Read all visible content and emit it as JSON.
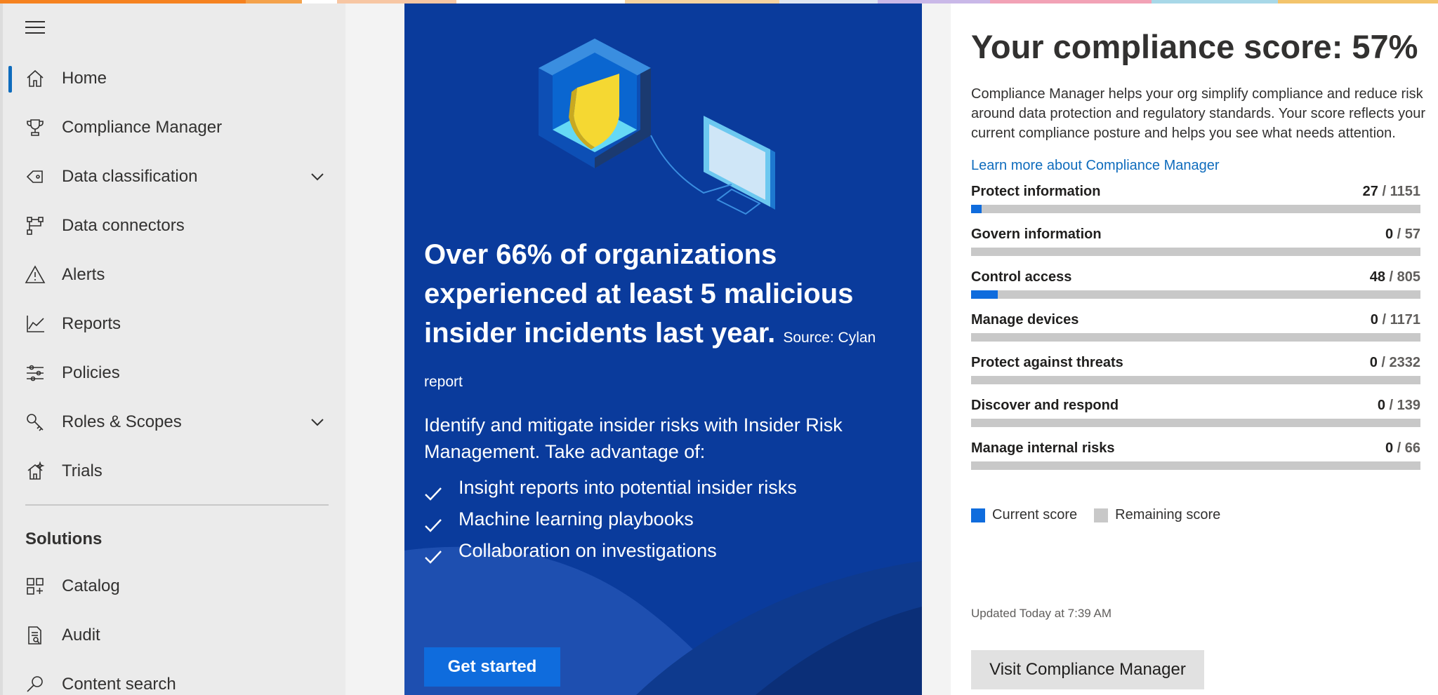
{
  "colors": {
    "accent": "#0f6cbd",
    "promo_bg": "#0a3b9c",
    "score_fill": "#0f6cdd",
    "score_remaining": "#c8c8c8",
    "top_strip": [
      "#f58220",
      "#f4a24b",
      "#ffffff",
      "#f7c6a3",
      "#ffffff",
      "#f6d3a0",
      "#dfe6f2",
      "#c9b8e8",
      "#f2a2b6",
      "#a8d8e8",
      "#f3c46c"
    ]
  },
  "sidebar": {
    "menu_icon": "hamburger-icon",
    "items": [
      {
        "label": "Home",
        "icon": "home-icon",
        "active": true
      },
      {
        "label": "Compliance Manager",
        "icon": "trophy-icon"
      },
      {
        "label": "Data classification",
        "icon": "tag-icon",
        "expandable": true
      },
      {
        "label": "Data connectors",
        "icon": "connector-icon"
      },
      {
        "label": "Alerts",
        "icon": "warning-icon"
      },
      {
        "label": "Reports",
        "icon": "chart-icon"
      },
      {
        "label": "Policies",
        "icon": "sliders-icon"
      },
      {
        "label": "Roles & Scopes",
        "icon": "key-icon",
        "expandable": true
      },
      {
        "label": "Trials",
        "icon": "trials-icon"
      }
    ],
    "section_title": "Solutions",
    "solutions": [
      {
        "label": "Catalog",
        "icon": "catalog-icon"
      },
      {
        "label": "Audit",
        "icon": "audit-icon"
      },
      {
        "label": "Content search",
        "icon": "search-icon"
      }
    ]
  },
  "promo": {
    "headline": "Over 66% of organizations experienced at least 5 malicious insider incidents last year.",
    "source": "Source: Cylan report",
    "description": "Identify and mitigate insider risks with Insider Risk Management. Take advantage of:",
    "bullets": [
      "Insight reports into potential insider risks",
      "Machine learning playbooks",
      "Collaboration on investigations"
    ],
    "button": "Get started"
  },
  "compliance": {
    "title": "Your compliance score: 57%",
    "description_lines": [
      "Compliance Manager helps your org simplify compliance and reduce risk",
      "around data protection and regulatory standards. Your score reflects your",
      "current compliance posture and helps you see what needs attention."
    ],
    "learn_more": "Learn more about Compliance Manager",
    "categories": [
      {
        "name": "Protect information",
        "score": "27",
        "total": "/ 1151",
        "fraction": 0.0235
      },
      {
        "name": "Govern information",
        "score": "0",
        "total": "/ 57",
        "fraction": 0
      },
      {
        "name": "Control access",
        "score": "48",
        "total": "/ 805",
        "fraction": 0.0596
      },
      {
        "name": "Manage devices",
        "score": "0",
        "total": "/ 1171",
        "fraction": 0
      },
      {
        "name": "Protect against threats",
        "score": "0",
        "total": "/ 2332",
        "fraction": 0
      },
      {
        "name": "Discover and respond",
        "score": "0",
        "total": "/ 139",
        "fraction": 0
      },
      {
        "name": "Manage internal risks",
        "score": "0",
        "total": "/ 66",
        "fraction": 0
      }
    ],
    "legend": {
      "current": "Current score",
      "remaining": "Remaining score"
    },
    "updated": "Updated Today at 7:39 AM",
    "button": "Visit Compliance Manager"
  }
}
